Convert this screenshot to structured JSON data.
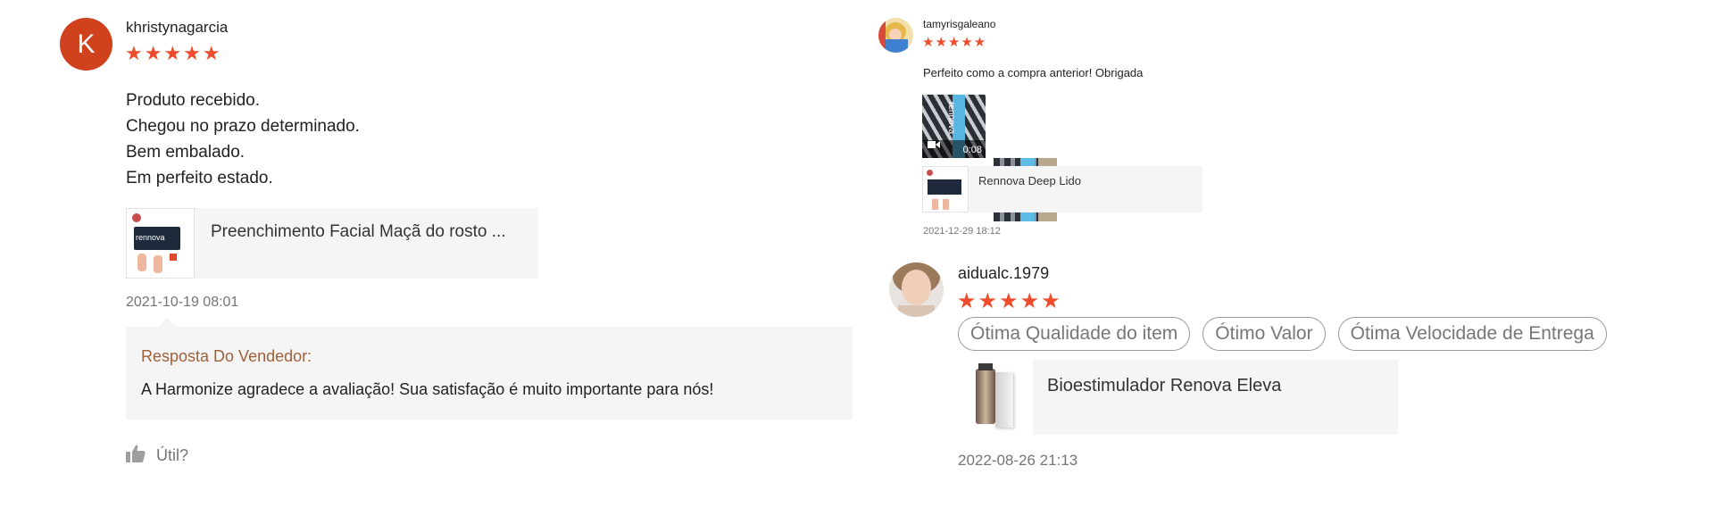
{
  "review1": {
    "avatar_letter": "K",
    "username": "khristynagarcia",
    "stars": "★★★★★",
    "body": [
      "Produto recebido.",
      "Chegou no prazo determinado.",
      "Bem embalado.",
      "Em perfeito estado."
    ],
    "product_name": "Preenchimento Facial Maçã do rosto ...",
    "product_thumb_text": "rennova",
    "date": "2021-10-19 08:01",
    "reply_title": "Resposta Do Vendedor:",
    "reply_text": "A Harmonize agradece a avaliação! Sua satisfação é muito importante para nós!",
    "helpful_label": "Útil?"
  },
  "review2": {
    "username": "tamyrisgaleano",
    "stars": "★★★★★",
    "body": "Perfeito como a compra anterior! Obrigada",
    "video_duration": "0:08",
    "media_text": "rennova",
    "product_name": "Rennova Deep Lido",
    "date": "2021-12-29 18:12"
  },
  "review3": {
    "username": "aidualc.1979",
    "stars": "★★★★★",
    "tags": [
      "Ótima Qualidade do item",
      "Ótimo Valor",
      "Ótima Velocidade de Entrega"
    ],
    "product_name": "Bioestimulador Renova Eleva",
    "date": "2022-08-26 21:13"
  },
  "colors": {
    "star": "#ee4d2d",
    "reply_title": "#a0603a",
    "avatar_k": "#d0411e"
  }
}
